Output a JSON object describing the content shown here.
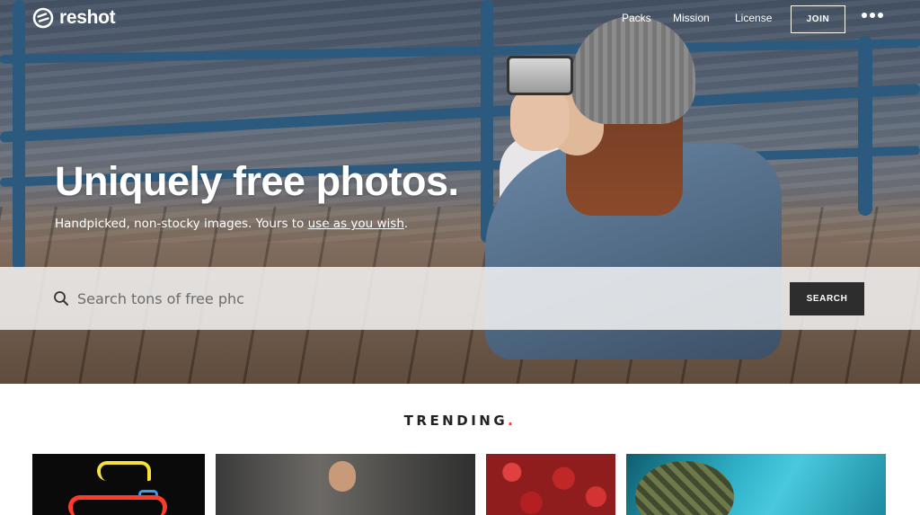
{
  "brand": {
    "name": "reshot"
  },
  "nav": {
    "links": [
      "Packs",
      "Mission",
      "License"
    ],
    "join_label": "JOIN"
  },
  "hero": {
    "headline": "Uniquely free photos.",
    "subline_pre": "Handpicked, non-stocky images. Yours to ",
    "subline_link": "use as you wish",
    "subline_post": "."
  },
  "search": {
    "value": "",
    "placeholder": "Search tons of free phc",
    "button_label": "SEARCH"
  },
  "trending": {
    "title": "TRENDING",
    "dot": "."
  },
  "colors": {
    "accent_dot": "#e63c2e",
    "search_button": "#2d2d2d"
  },
  "icons": [
    "reshot-logo-icon",
    "more-dots-icon",
    "search-icon"
  ]
}
